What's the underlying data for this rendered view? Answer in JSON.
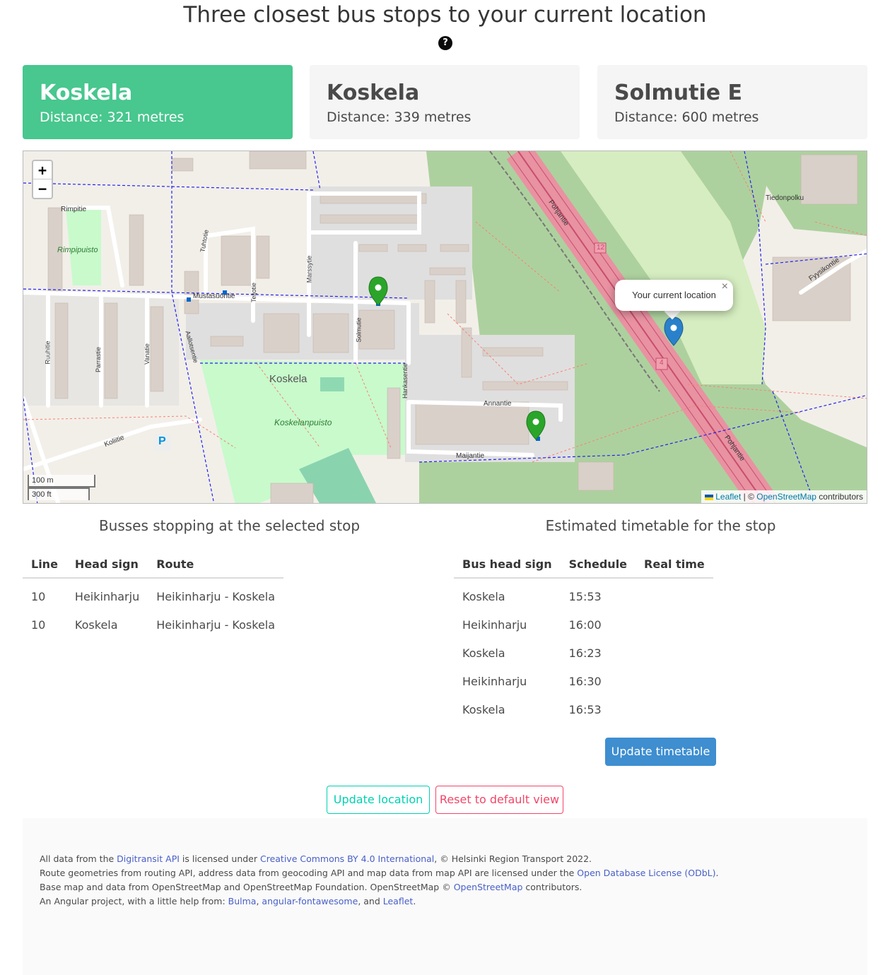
{
  "header": {
    "title": "Three closest bus stops to your current location",
    "help_icon_text": "?"
  },
  "stops": [
    {
      "name": "Koskela",
      "distance": "Distance: 321 metres",
      "selected": true
    },
    {
      "name": "Koskela",
      "distance": "Distance: 339 metres",
      "selected": false
    },
    {
      "name": "Solmutie E",
      "distance": "Distance: 600 metres",
      "selected": false
    }
  ],
  "map": {
    "zoom_in": "+",
    "zoom_out": "−",
    "scale_metric": "100 m",
    "scale_imperial": "300 ft",
    "popup_text": "Your current location",
    "popup_close": "×",
    "attribution": {
      "leaflet": "Leaflet",
      "separator": " | © ",
      "osm": "OpenStreetMap",
      "suffix": " contributors"
    },
    "labels": {
      "koskela": "Koskela",
      "koskelanpuisto": "Koskelanpuisto",
      "rimpipuisto": "Rimpipuisto",
      "rimpitie": "Rimpitie",
      "mustasuontie": "Mustasuontie",
      "annantie": "Annantie",
      "maijantie": "Maijantie",
      "koliitie": "Koliitie",
      "pohjantie_1": "Pohjantie",
      "pohjantie_2": "Pohjantie",
      "tiedonpolku": "Tiedonpolku",
      "fyysikontie": "Fyysikontie",
      "hankasentie": "Hankasentie",
      "solmutie": "Solmutie",
      "marssytie": "Marssytie",
      "tuhtotie": "Tuhtotie",
      "teljotie": "Teljotie",
      "ruuhitie": "Ruuhitie",
      "parrastie": "Parrastie",
      "vanatie": "Vanatie",
      "aallotsentie": "Aallotsentie",
      "road_12": "12",
      "road_4": "4",
      "parking": "P"
    }
  },
  "routes": {
    "title": "Busses stopping at the selected stop",
    "headers": [
      "Line",
      "Head sign",
      "Route"
    ],
    "rows": [
      {
        "line": "10",
        "head_sign": "Heikinharju",
        "route": "Heikinharju - Koskela"
      },
      {
        "line": "10",
        "head_sign": "Koskela",
        "route": "Heikinharju - Koskela"
      }
    ]
  },
  "timetable": {
    "title": "Estimated timetable for the stop",
    "headers": [
      "Bus head sign",
      "Schedule",
      "Real time"
    ],
    "rows": [
      {
        "head_sign": "Koskela",
        "schedule": "15:53",
        "real_time": ""
      },
      {
        "head_sign": "Heikinharju",
        "schedule": "16:00",
        "real_time": ""
      },
      {
        "head_sign": "Koskela",
        "schedule": "16:23",
        "real_time": ""
      },
      {
        "head_sign": "Heikinharju",
        "schedule": "16:30",
        "real_time": ""
      },
      {
        "head_sign": "Koskela",
        "schedule": "16:53",
        "real_time": ""
      }
    ],
    "update_button": "Update timetable"
  },
  "actions": {
    "update_location": "Update location",
    "reset_view": "Reset to default view"
  },
  "footer": {
    "line1": {
      "t1": "All data from the ",
      "l1": "Digitransit API",
      "t2": " is licensed under ",
      "l2": "Creative Commons BY 4.0 International",
      "t3": ", © Helsinki Region Transport 2022."
    },
    "line2": {
      "t1": "Route geometries from routing API, address data from geocoding API and map data from map API are licensed under the ",
      "l1": "Open Database License (ODbL)",
      "t2": "."
    },
    "line3": {
      "t1": "Base map and data from OpenStreetMap and OpenStreetMap Foundation. OpenStreetMap © ",
      "l1": "OpenStreetMap",
      "t2": " contributors."
    },
    "line4": {
      "t1": "An Angular project, with a little help from: ",
      "l1": "Bulma",
      "t2": ", ",
      "l2": "angular-fontawesome",
      "t3": ", and ",
      "l3": "Leaflet",
      "t4": "."
    }
  },
  "colors": {
    "selected_card": "#48c78e",
    "card": "#f5f5f5",
    "update_timetable": "#3e8ed0",
    "update_location": "#00d1b2",
    "reset": "#f14668",
    "stop_marker": "#2aa52a",
    "location_marker": "#2a81cb"
  }
}
